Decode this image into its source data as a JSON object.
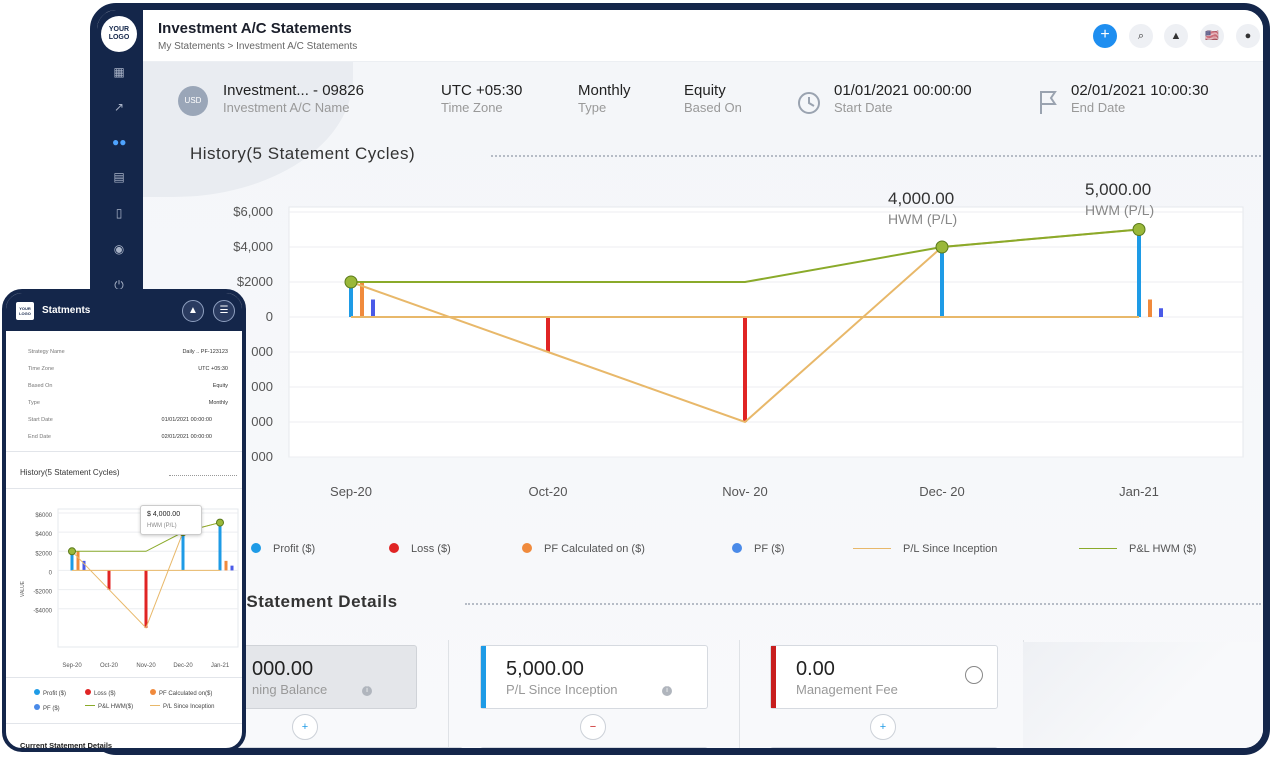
{
  "app": {
    "logo": "YOUR LOGO"
  },
  "header": {
    "title": "Investment A/C Statements",
    "breadcrumb": "My Statements > Investment A/C Statements",
    "lang_flag": "🇺🇸"
  },
  "info": {
    "currency": "USD",
    "account": {
      "value": "Investment... - 09826",
      "label": "Investment A/C Name"
    },
    "timezone": {
      "value": "UTC +05:30",
      "label": "Time Zone"
    },
    "type": {
      "value": "Monthly",
      "label": "Type"
    },
    "based_on": {
      "value": "Equity",
      "label": "Based On"
    },
    "start_date": {
      "value": "01/01/2021 00:00:00",
      "label": "Start Date"
    },
    "end_date": {
      "value": "02/01/2021 10:00:30",
      "label": "End Date"
    }
  },
  "history_title": "History(5 Statement Cycles)",
  "annotations": [
    {
      "value": "4,000.00",
      "label": "HWM (P/L)"
    },
    {
      "value": "5,000.00",
      "label": "HWM (P/L)"
    }
  ],
  "chart_data": {
    "type": "bar",
    "categories": [
      "Sep-20",
      "Oct-20",
      "Nov- 20",
      "Dec- 20",
      "Jan-21"
    ],
    "y_tick_labels": [
      "$6,000",
      "$4,000",
      "$2000",
      "0",
      "000",
      "000",
      "000",
      "000"
    ],
    "ylim": [
      -8000,
      6000
    ],
    "grid": true,
    "legend_position": "bottom",
    "series": [
      {
        "name": "Profit ($)",
        "kind": "bar",
        "color": "#1e9be6",
        "values": [
          2000,
          0,
          0,
          4000,
          5000
        ]
      },
      {
        "name": "Loss ($)",
        "kind": "bar",
        "color": "#e02424",
        "values": [
          0,
          -2000,
          -6000,
          0,
          0
        ]
      },
      {
        "name": "PF Calculated on ($)",
        "kind": "bar",
        "color": "#f08a3c",
        "values": [
          2000,
          0,
          0,
          0,
          1000
        ]
      },
      {
        "name": "PF ($)",
        "kind": "bar",
        "color": "#4a5ae8",
        "values": [
          1000,
          0,
          0,
          0,
          500
        ]
      },
      {
        "name": "P/L Since Inception",
        "kind": "line",
        "color": "#e8b86a",
        "values": [
          2000,
          -2000,
          -6000,
          4000,
          5000
        ]
      },
      {
        "name": "P&L HWM ($)",
        "kind": "line",
        "color": "#8aaa2a",
        "values": [
          2000,
          2000,
          2000,
          4000,
          5000
        ]
      }
    ]
  },
  "details_title": "t Statement Details",
  "cards": [
    {
      "value": "000.00",
      "label": "ning Balance",
      "accent": "#d0d3d8"
    },
    {
      "value": "5,000.00",
      "label": "P/L Since Inception",
      "accent": "#1e9be6"
    },
    {
      "value": "0.00",
      "label": "Management Fee",
      "accent": "#c81e1e"
    }
  ],
  "card_icons": [
    "+",
    "−",
    "+"
  ],
  "phone": {
    "logo": "YOUR LOGO",
    "title": "Statments",
    "rows": [
      {
        "label": "Strategy Name",
        "value": "Daily .. PF-123123"
      },
      {
        "label": "Time Zone",
        "value": "UTC +05:30"
      },
      {
        "label": "Based On",
        "value": "Equity"
      },
      {
        "label": "Type",
        "value": "Monthly"
      },
      {
        "label": "Start Date",
        "value": "01/01/2021 00:00:00"
      },
      {
        "label": "End Date",
        "value": "02/01/2021 00:00:00"
      }
    ],
    "history_title": "History(5 Statement Cycles)",
    "tooltip": {
      "value": "$ 4,000.00",
      "label": "HWM (P/L)"
    },
    "y_ticks": [
      "$6000",
      "$4000",
      "$2000",
      "0",
      "-$2000",
      "-$4000"
    ],
    "y_axis_label": "VALUE",
    "x_ticks": [
      "Sep-20",
      "Oct-20",
      "Nov-20",
      "Dec-20",
      "Jan-21"
    ],
    "legend": [
      "Profit ($)",
      "Loss ($)",
      "PF Calculated on($)",
      "PF ($)",
      "P&L HWM($)",
      "P/L Since Inception"
    ],
    "footer": "Current Statement Details"
  }
}
